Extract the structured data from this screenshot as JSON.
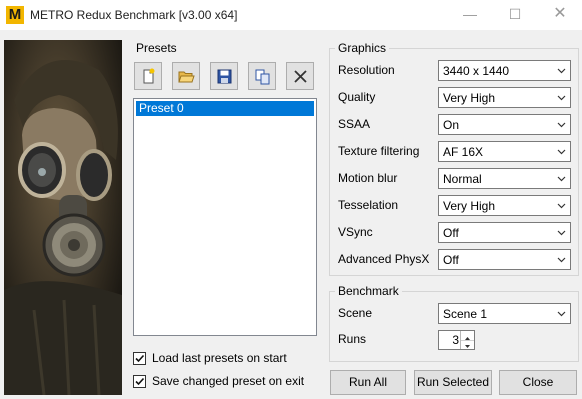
{
  "window": {
    "title": "METRO Redux Benchmark [v3.00 x64]",
    "icon_letter": "M"
  },
  "presets": {
    "group_label": "Presets",
    "toolbar": [
      "new-icon",
      "open-folder-icon",
      "save-icon",
      "copy-icon",
      "delete-icon"
    ],
    "items": [
      "Preset 0"
    ],
    "selected": "Preset 0",
    "load_last_label": "Load last presets on start",
    "load_last_checked": true,
    "save_changed_label": "Save changed preset on exit",
    "save_changed_checked": true
  },
  "graphics": {
    "group_label": "Graphics",
    "rows": [
      {
        "label": "Resolution",
        "value": "3440 x 1440"
      },
      {
        "label": "Quality",
        "value": "Very High"
      },
      {
        "label": "SSAA",
        "value": "On"
      },
      {
        "label": "Texture filtering",
        "value": "AF 16X"
      },
      {
        "label": "Motion blur",
        "value": "Normal"
      },
      {
        "label": "Tesselation",
        "value": "Very High"
      },
      {
        "label": "VSync",
        "value": "Off"
      },
      {
        "label": "Advanced PhysX",
        "value": "Off"
      }
    ]
  },
  "benchmark": {
    "group_label": "Benchmark",
    "scene_label": "Scene",
    "scene_value": "Scene 1",
    "runs_label": "Runs",
    "runs_value": "3"
  },
  "buttons": {
    "run_all": "Run All",
    "run_selected": "Run Selected",
    "close": "Close"
  },
  "colors": {
    "selection": "#0078d7",
    "accent_icon": "#f2b600"
  }
}
